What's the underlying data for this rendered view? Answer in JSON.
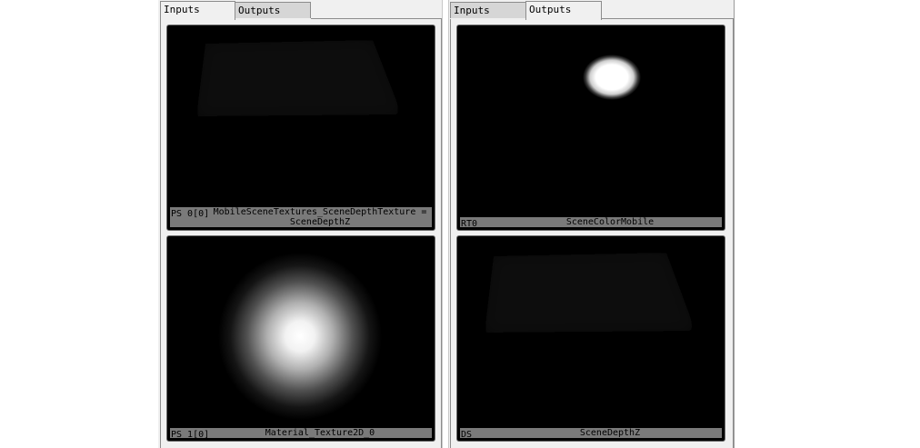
{
  "left_panel": {
    "tabs": [
      "Inputs",
      "Outputs"
    ],
    "active_tab": "Inputs",
    "thumbnails": [
      {
        "slot": "PS 0[0]",
        "name": "MobileSceneTextures_SceneDepthTexture = SceneDepthZ"
      },
      {
        "slot": "PS 1[0]",
        "name": "Material_Texture2D_0"
      }
    ]
  },
  "right_panel": {
    "tabs": [
      "Inputs",
      "Outputs"
    ],
    "active_tab": "Outputs",
    "thumbnails": [
      {
        "slot": "RT0",
        "name": "SceneColorMobile"
      },
      {
        "slot": "DS",
        "name": "SceneDepthZ"
      }
    ]
  },
  "colors": {
    "panel_bg": "#f0f0f0",
    "thumb_bg": "#000000",
    "caption_bg": "#7a7a7a"
  }
}
